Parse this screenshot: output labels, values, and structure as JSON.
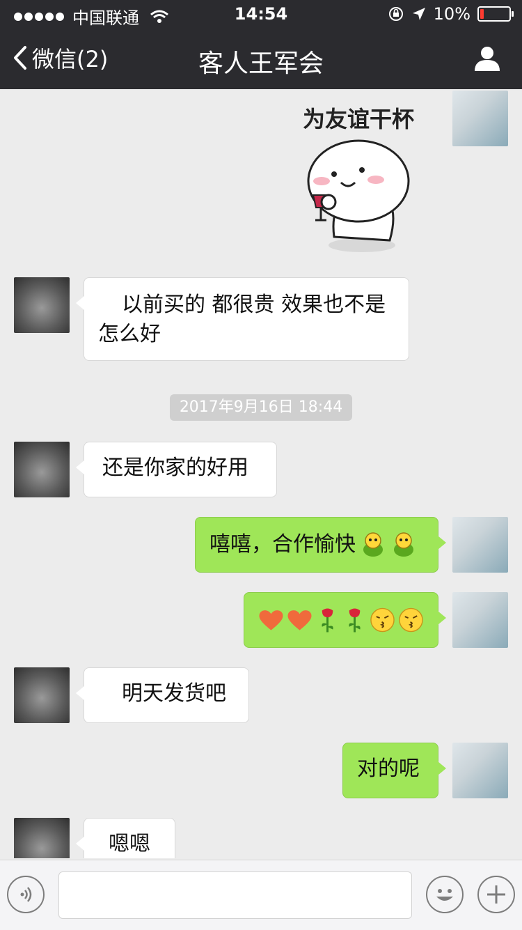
{
  "status_bar": {
    "carrier": "中国联通",
    "time": "14:54",
    "battery": "10%"
  },
  "nav": {
    "back_label": "微信(2)",
    "title": "客人王军会"
  },
  "sticker": {
    "caption": "为友谊干杯"
  },
  "messages": [
    {
      "side": "in",
      "text": "以前买的 都很贵 效果也不是怎么好"
    },
    {
      "side": "in",
      "text": "还是你家的好用"
    },
    {
      "side": "out",
      "text": "嘻嘻，合作愉快"
    },
    {
      "side": "out",
      "emojis": [
        "heart-icon",
        "heart-icon",
        "rose-icon",
        "rose-icon",
        "kiss-face-icon",
        "kiss-face-icon"
      ]
    },
    {
      "side": "in",
      "text": "明天发货吧"
    },
    {
      "side": "out",
      "text": "对的呢"
    },
    {
      "side": "in",
      "text": "嗯嗯"
    }
  ],
  "timestamp": "2017年9月16日 18:44",
  "colors": {
    "nav_bg": "#2b2b2f",
    "chat_bg": "#ececec",
    "outgoing_bubble": "#9fe658",
    "incoming_bubble": "#ffffff",
    "battery_low": "#ff3b30"
  }
}
